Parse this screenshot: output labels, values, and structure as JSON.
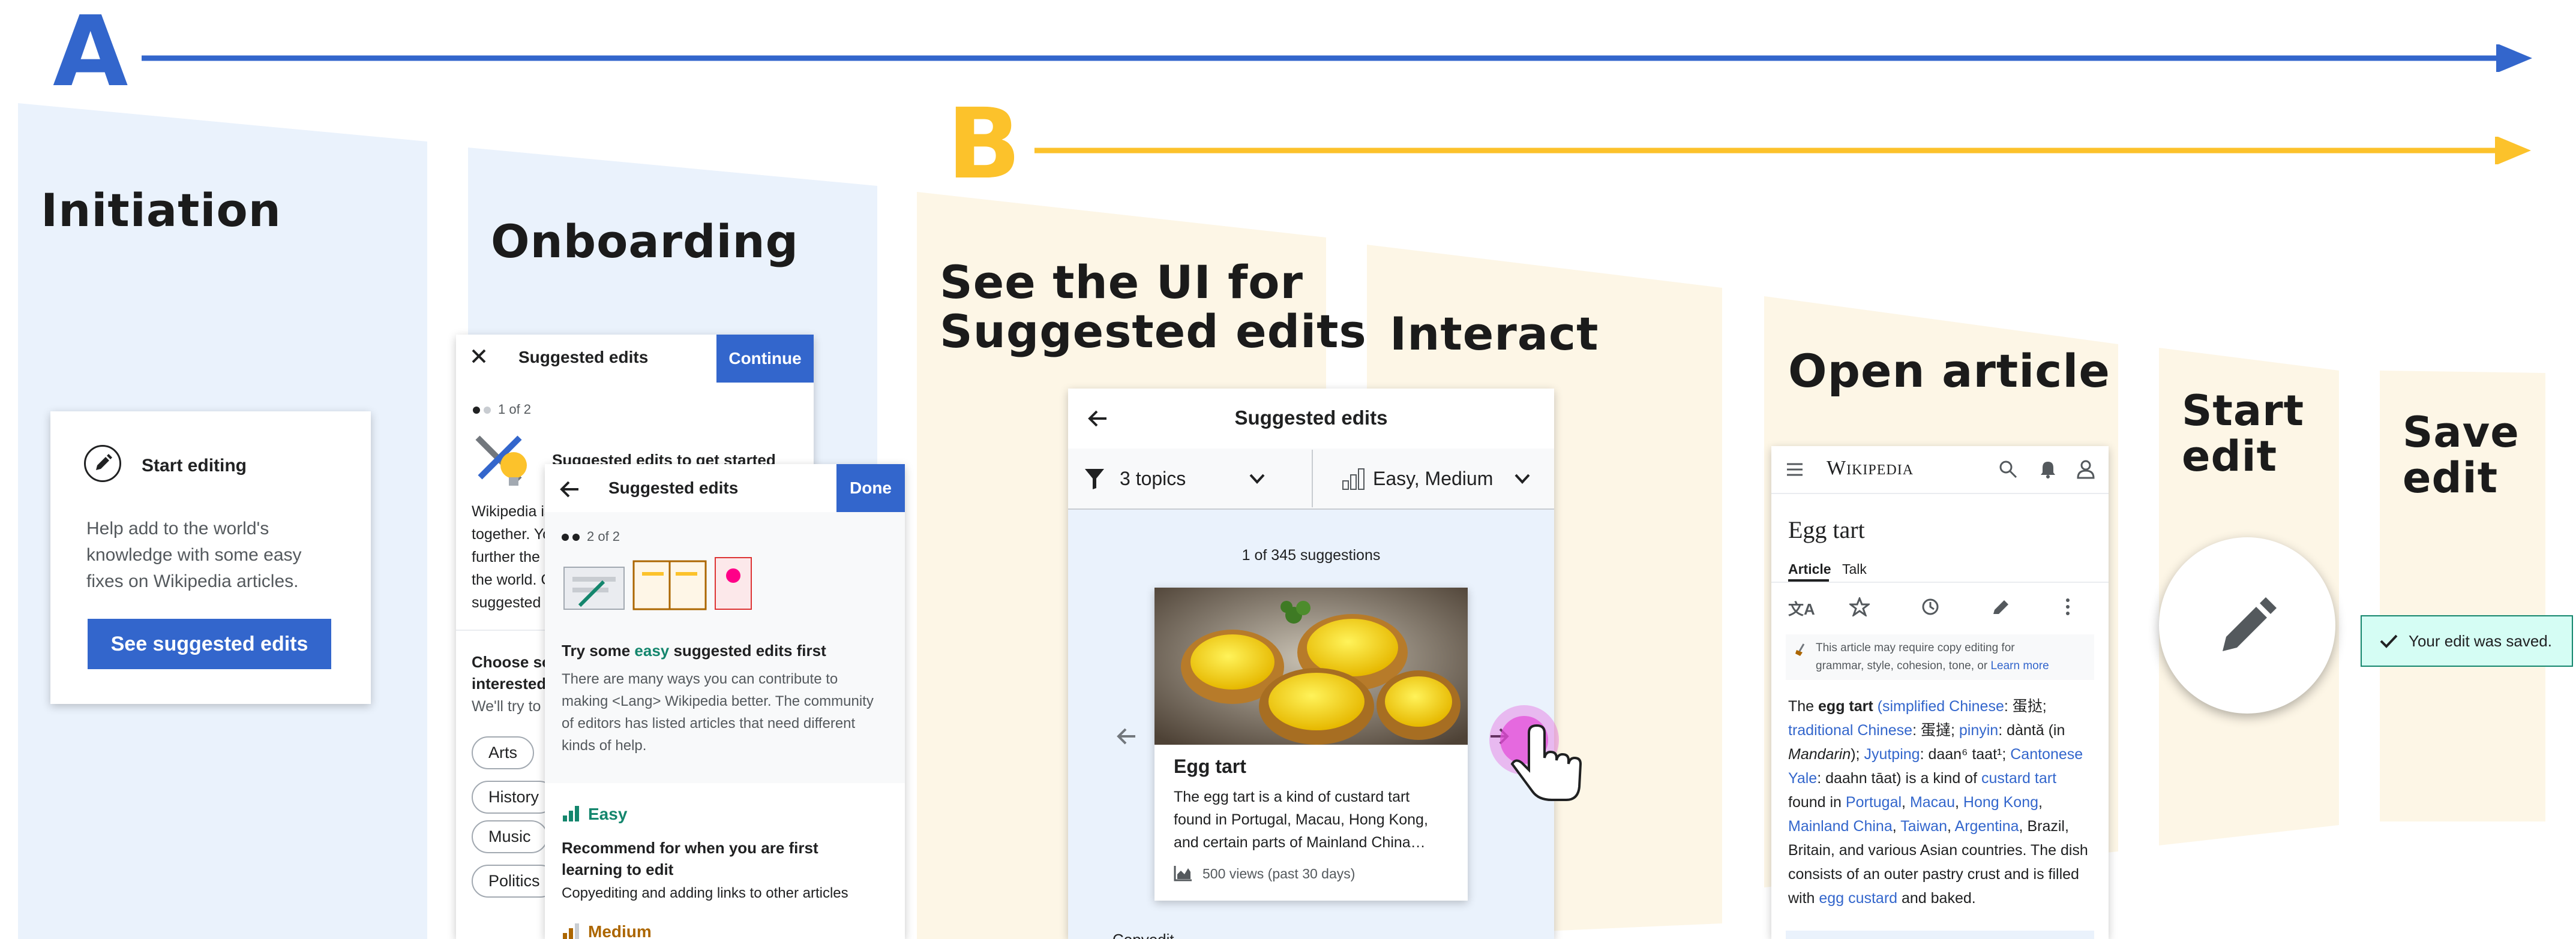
{
  "colors": {
    "track_a": "#3366cc",
    "track_b": "#fcc22b",
    "blue_panel": "#eaf2fc",
    "cream_panel": "#fdf6e6",
    "accent_blue": "#3366cc",
    "easy_green": "#14866d",
    "medium_orange": "#ac6600",
    "tap_pink": "#e44fd9",
    "success_green": "#14866d"
  },
  "tracks": {
    "a_label": "A",
    "b_label": "B"
  },
  "stages": {
    "initiation": "Initiation",
    "onboarding": "Onboarding",
    "see_ui_line1": "See the UI for",
    "see_ui_line2": "Suggested edits",
    "interact": "Interact",
    "open_article": "Open article",
    "start_edit_line1": "Start",
    "start_edit_line2": "edit",
    "save_edit_line1": "Save",
    "save_edit_line2": "edit"
  },
  "initiation_card": {
    "title": "Start editing",
    "icon": "pencil-icon",
    "body_line1": "Help add to the world's",
    "body_line2": "knowledge with some easy",
    "body_line3": "fixes on Wikipedia articles.",
    "button": "See suggested edits"
  },
  "onboarding_back": {
    "title": "Suggested edits",
    "button": "Continue",
    "step": "1 of 2",
    "heading": "Suggested edits to get started",
    "body_lines": [
      "Wikipedia is",
      "together. Yo",
      "further the m",
      "the world. C",
      "suggested e"
    ],
    "choose_line1": "Choose so",
    "choose_line2": "interested",
    "try_line": "We'll try to",
    "chips": [
      "Arts",
      "History",
      "Music",
      "Politics"
    ]
  },
  "onboarding_front": {
    "title": "Suggested edits",
    "button": "Done",
    "step": "2 of 2",
    "heading_pre": "Try some ",
    "heading_accent": "easy",
    "heading_post": " suggested edits first",
    "body_lines": [
      "There are many ways you can contribute to",
      "making <Lang> Wikipedia better. The community",
      "of editors has listed articles that need different",
      "kinds of help."
    ],
    "easy_label": "Easy",
    "easy_title_line1": "Recommend for when you are first",
    "easy_title_line2": "learning to edit",
    "easy_desc": "Copyediting and adding links to other articles",
    "medium_label": "Medium"
  },
  "suggested_ui": {
    "title": "Suggested edits",
    "topics_filter": "3 topics",
    "difficulty_filter": "Easy, Medium",
    "count": "1 of 345 suggestions",
    "card_title": "Egg tart",
    "card_desc_lines": [
      "The egg tart is a kind of custard tart",
      "found in Portugal, Macau, Hong Kong,",
      "and certain parts of Mainland China…"
    ],
    "views": "500 views (past 30 days)",
    "footer_partial": "Copyedit"
  },
  "article": {
    "wordmark": "Wikipedia",
    "title": "Egg tart",
    "tab_article": "Article",
    "tab_talk": "Talk",
    "notice_line1": "This article may require copy editing for",
    "notice_line2": "grammar, style, cohesion, tone, or",
    "learn_more": "Learn more",
    "body": {
      "l1_pre": "The ",
      "l1_bold": "egg tart",
      "l1_link": " (simplified Chinese",
      "l1_post": ": 蛋挞;",
      "l2_link1": "traditional Chinese",
      "l2_mid": ": 蛋撻; ",
      "l2_link2": "pinyin",
      "l2_post": ": dàntǎ (in",
      "l3_italic": "Mandarin",
      "l3_mid": "); ",
      "l3_link1": "Jyutping",
      "l3_mid2": ": daan⁶ taat¹; ",
      "l3_link2": "Cantonese",
      "l4_link": "Yale",
      "l4_mid": ": daahn tāat) is a kind of ",
      "l4_link2": "custard tart",
      "l5_pre": "found in ",
      "l5_link1": "Portugal",
      "l5_c1": ", ",
      "l5_link2": "Macau",
      "l5_c2": ", ",
      "l5_link3": "Hong Kong",
      "l5_c3": ",",
      "l6_link1": "Mainland China",
      "l6_c1": ", ",
      "l6_link2": "Taiwan",
      "l6_c2": ", ",
      "l6_link3": "Argentina",
      "l6_post": ", Brazil,",
      "l7": "Britain, and various Asian countries. The dish",
      "l8": "consists of an outer pastry crust and is filled",
      "l9_pre": "with ",
      "l9_link": "egg custard",
      "l9_post": " and baked."
    }
  },
  "save_toast": "Your edit was saved."
}
